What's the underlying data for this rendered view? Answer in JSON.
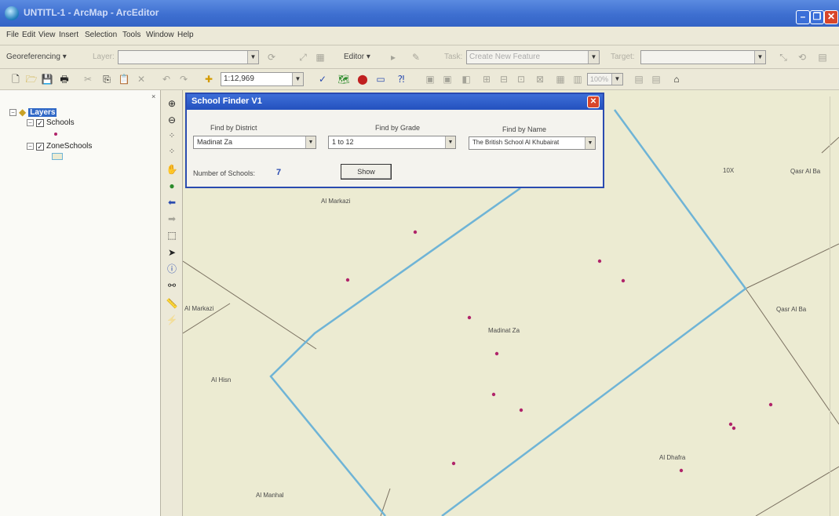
{
  "window": {
    "title": "UNTITL-1 - ArcMap - ArcEditor",
    "buttons": {
      "minimize": "–",
      "maximize": "❐",
      "close": "✕"
    }
  },
  "menu": [
    "File",
    "Edit",
    "View",
    "Insert",
    "Selection",
    "Tools",
    "Window",
    "Help"
  ],
  "toolbar1": {
    "georeferencing_label": "Georeferencing",
    "layer_label": "Layer:",
    "layer_value": "",
    "editor_label": "Editor",
    "task_label": "Task:",
    "task_value": "Create New Feature",
    "target_label": "Target:",
    "target_value": ""
  },
  "toolbar2": {
    "scale_value": "1:12,969",
    "zoom_value": "100%"
  },
  "toc": {
    "close": "×",
    "root_label": "Layers",
    "layers": [
      {
        "name": "Schools",
        "checked": true
      },
      {
        "name": "ZoneSchools",
        "checked": true
      }
    ]
  },
  "dialog": {
    "title": "School Finder V1",
    "close": "✕",
    "district_label": "Find by District",
    "district_value": "Madinat Za",
    "grade_label": "Find by Grade",
    "grade_value": "1 to 12",
    "name_label": "Find by Name",
    "name_value": "The British School Al Khubairat",
    "count_label": "Number of Schools:",
    "count_value": "7",
    "show_button": "Show"
  },
  "map": {
    "labels": {
      "al_markazi_top": "Al Markazi",
      "al_markazi_left": "Al Markazi",
      "madinat_za": "Madinat Za",
      "al_hisn": "Al Hisn",
      "al_dhafra": "Al Dhafra",
      "al_manhal": "Al Manhal",
      "tox": "10X",
      "qasr_al_ba_top": "Qasr Al Ba",
      "qasr_al_ba_mid": "Qasr Al Ba"
    },
    "colors": {
      "background": "#ecebd2",
      "zone_outline": "#6fb4d6",
      "boundary": "#7a7060",
      "school_point": "#b0246a"
    }
  }
}
